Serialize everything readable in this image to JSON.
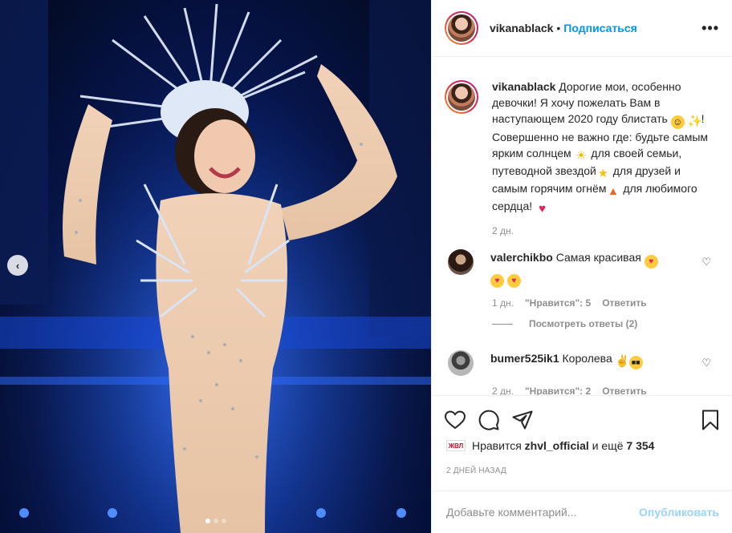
{
  "post": {
    "username": "vikanablack",
    "follow_label": "Подписаться",
    "separator": "•",
    "more_label": "•••"
  },
  "caption": {
    "username": "vikanablack",
    "line1": "Дорогие мои, особенно девочки! Я хочу пожелать Вам в наступающем 2020 году блистать",
    "line1_end": "!",
    "line2a": "Совершенно не важно где: будьте самым ярким солнцем",
    "line2b": "для своей семьи, путеводной звездой",
    "line2c": "для друзей и самым горячим огнём",
    "line2d": "для любимого сердца!",
    "time": "2 дн."
  },
  "comments": [
    {
      "username": "valerchikbo",
      "text": "Самая красивая",
      "time": "1 дн.",
      "likes": "\"Нравится\": 5",
      "reply": "Ответить",
      "view_replies": "Посмотреть ответы (2)"
    },
    {
      "username": "bumer525ik1",
      "text": "Королева",
      "time": "2 дн.",
      "likes": "\"Нравится\": 2",
      "reply": "Ответить"
    }
  ],
  "likes": {
    "badge": "ЖВЛ",
    "prefix": "Нравится",
    "user": "zhvl_official",
    "middle": "и ещё",
    "count": "7 354"
  },
  "date": "2 ДНЕЙ НАЗАД",
  "add_comment": {
    "placeholder": "Добавьте комментарий...",
    "publish_label": "Опубликовать"
  },
  "nav": {
    "prev_label": "‹"
  },
  "carousel": {
    "slides": 3,
    "active_index": 0
  },
  "colors": {
    "accent": "#0095f6",
    "text": "#262626",
    "muted": "#8e8e8e",
    "border": "#efefef"
  },
  "icons": [
    "heart-icon",
    "comment-icon",
    "share-icon",
    "bookmark-icon",
    "more-icon",
    "chevron-left-icon"
  ]
}
